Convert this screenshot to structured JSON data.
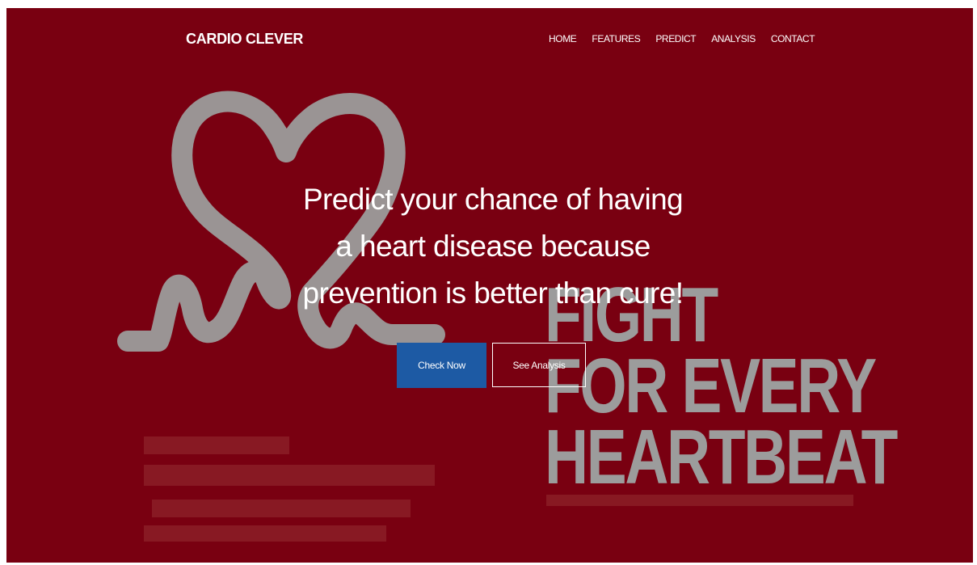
{
  "brand": {
    "name": "CARDIO CLEVER"
  },
  "nav": {
    "items": [
      {
        "label": "HOME"
      },
      {
        "label": "FEATURES"
      },
      {
        "label": "PREDICT"
      },
      {
        "label": "ANALYSIS"
      },
      {
        "label": "CONTACT"
      }
    ]
  },
  "hero": {
    "lines": [
      "Predict your chance of having",
      "a heart disease because",
      "prevention is better than cure!"
    ],
    "primary_button": "Check Now",
    "secondary_button": "See Analysis"
  },
  "background": {
    "slogan_lines": [
      "FIGHT",
      "FOR EVERY",
      "HEARTBEAT"
    ],
    "icon": "heart-pulse-logo"
  },
  "colors": {
    "background": "#790011",
    "primary_button": "#1d5aa4",
    "artwork": "#9c9c9c",
    "text": "#ffffff"
  }
}
